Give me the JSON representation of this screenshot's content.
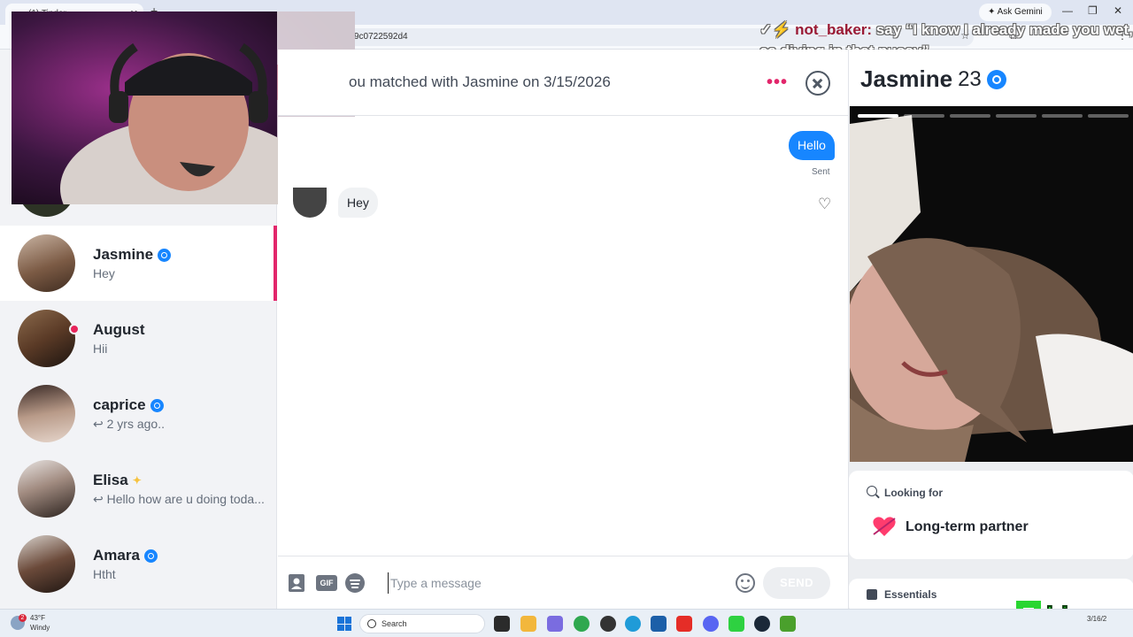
{
  "browser": {
    "tab_title": "(1) Tinder",
    "ask_gemini": "Ask Gemini",
    "url_fragment": "9c0722592d4"
  },
  "stream_chat": {
    "username": "not_baker:",
    "message": "say “I know I already made you wet, ca diving in that pussy”"
  },
  "sidebar": {
    "items": [
      {
        "name": "Jasmine",
        "preview": "Hey",
        "verified": true,
        "active": true
      },
      {
        "name": "August",
        "preview": "Hii",
        "online": true
      },
      {
        "name": "caprice",
        "preview": "2 yrs ago..",
        "verified": true,
        "replied": true
      },
      {
        "name": "Elisa",
        "preview": "Hello how are u doing toda...",
        "sparkle": true,
        "replied": true
      },
      {
        "name": "Amara",
        "preview": "Htht",
        "verified": true
      }
    ]
  },
  "chat": {
    "match_text": "ou matched with Jasmine on 3/15/2026",
    "messages": [
      {
        "from": "me",
        "text": "Hello",
        "status": "Sent"
      },
      {
        "from": "them",
        "text": "Hey"
      }
    ],
    "composer": {
      "gif_label": "GIF",
      "placeholder": "Type a message",
      "send_label": "SEND"
    }
  },
  "profile": {
    "name": "Jasmine",
    "age": "23",
    "photo_count": 6,
    "current_photo": 1,
    "looking_for_label": "Looking for",
    "looking_for_value": "Long-term partner",
    "essentials_label": "Essentials"
  },
  "watermark": "himay",
  "taskbar": {
    "weather_temp": "43°F",
    "weather_cond": "Windy",
    "weather_badge": "2",
    "search_label": "Search",
    "clock_date": "3/16/2"
  },
  "colors": {
    "tinder_pink": "#e2266b",
    "sent_blue": "#1786ff",
    "verified_blue": "#1786ff",
    "sidebar_bg": "#f2f3f6"
  }
}
